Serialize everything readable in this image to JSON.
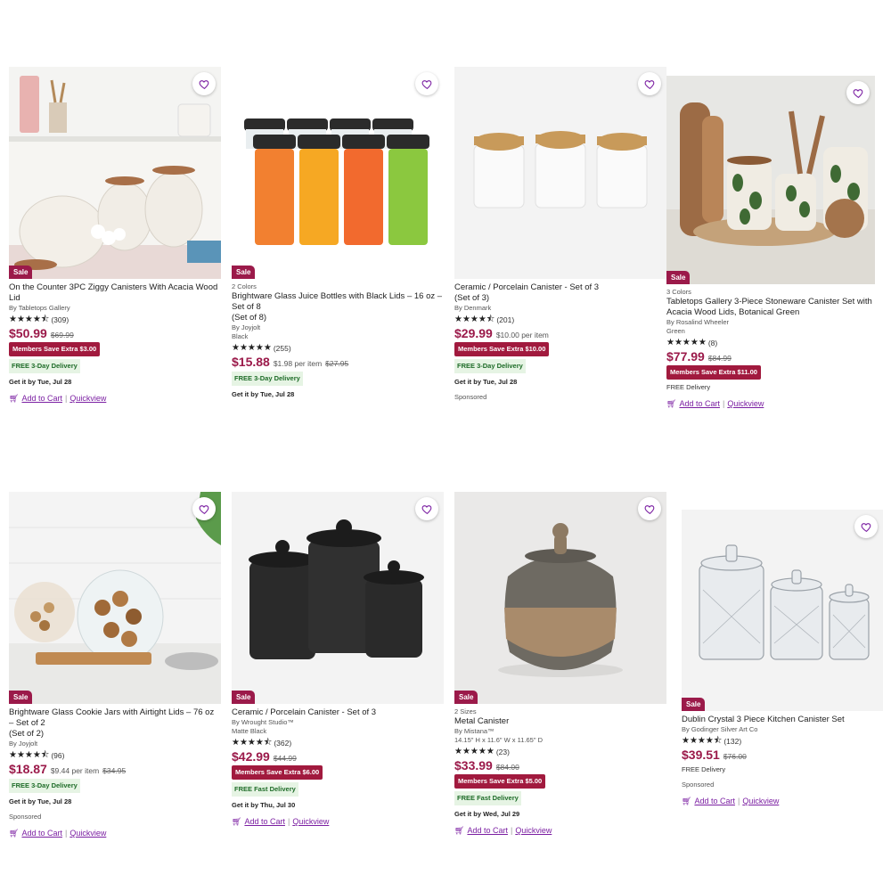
{
  "products": [
    {
      "id": "p1",
      "colors": "",
      "title": "On the Counter 3PC Ziggy Canisters With Acacia Wood Lid",
      "brand": "By Tabletops Gallery",
      "sub": "",
      "rating_count": "(309)",
      "stars": "★★★★⯪",
      "price": "$50.99",
      "per_item": "",
      "was": "$69.99",
      "members": "Members Save Extra $3.00",
      "shipping": "FREE 3-Day Delivery",
      "shipping_style": "green",
      "getit": "Get it by Tue, Jul 28",
      "sponsored": "",
      "sale": "Sale",
      "add_to_cart": "Add to Cart",
      "quickview": "Quickview"
    },
    {
      "id": "p2",
      "colors": "2 Colors",
      "title": "Brightware Glass Juice Bottles with Black Lids – 16 oz – Set of 8",
      "subtitle2": "(Set of 8)",
      "brand": "By Joyjolt",
      "sub": "Black",
      "rating_count": "(255)",
      "stars": "★★★★★",
      "price": "$15.88",
      "per_item": "$1.98 per item",
      "was": "$27.95",
      "members": "",
      "shipping": "FREE 3-Day Delivery",
      "shipping_style": "green",
      "getit": "Get it by Tue, Jul 28",
      "sponsored": "",
      "sale": "Sale",
      "add_to_cart": "",
      "quickview": ""
    },
    {
      "id": "p3",
      "colors": "",
      "title": "Ceramic / Porcelain Canister - Set of 3",
      "subtitle2": "(Set of 3)",
      "brand": "By Denmark",
      "sub": "",
      "rating_count": "(201)",
      "stars": "★★★★⯪",
      "price": "$29.99",
      "per_item": "$10.00 per item",
      "was": "",
      "members": "Members Save Extra $10.00",
      "shipping": "FREE 3-Day Delivery",
      "shipping_style": "green",
      "getit": "Get it by Tue, Jul 28",
      "sponsored": "Sponsored",
      "sale": "",
      "add_to_cart": "",
      "quickview": ""
    },
    {
      "id": "p4",
      "colors": "3 Colors",
      "title": "Tabletops Gallery 3-Piece Stoneware Canister Set with Acacia Wood Lids, Botanical Green",
      "brand": "By Rosalind Wheeler",
      "sub": "Green",
      "rating_count": "(8)",
      "stars": "★★★★★",
      "price": "$77.99",
      "per_item": "",
      "was": "$84.99",
      "members": "Members Save Extra $11.00",
      "shipping": "FREE Delivery",
      "shipping_style": "plain",
      "getit": "",
      "sponsored": "",
      "sale": "Sale",
      "add_to_cart": "Add to Cart",
      "quickview": "Quickview"
    },
    {
      "id": "p5",
      "colors": "",
      "title": "Brightware Glass Cookie Jars with Airtight Lids – 76 oz – Set of 2",
      "subtitle2": "(Set of 2)",
      "brand": "By Joyjolt",
      "sub": "",
      "rating_count": "(96)",
      "stars": "★★★★⯪",
      "price": "$18.87",
      "per_item": "$9.44 per item",
      "was": "$34.95",
      "members": "",
      "shipping": "FREE 3-Day Delivery",
      "shipping_style": "green",
      "getit": "Get it by Tue, Jul 28",
      "sponsored": "Sponsored",
      "sale": "Sale",
      "add_to_cart": "Add to Cart",
      "quickview": "Quickview"
    },
    {
      "id": "p6",
      "colors": "",
      "title": "Ceramic / Porcelain Canister - Set of 3",
      "brand": "By Wrought Studio™",
      "sub": "Matte Black",
      "rating_count": "(362)",
      "stars": "★★★★⯪",
      "price": "$42.99",
      "per_item": "",
      "was": "$44.99",
      "members": "Members Save Extra $6.00",
      "shipping": "FREE Fast Delivery",
      "shipping_style": "green",
      "getit": "Get it by Thu, Jul 30",
      "sponsored": "",
      "sale": "Sale",
      "add_to_cart": "Add to Cart",
      "quickview": "Quickview"
    },
    {
      "id": "p7",
      "colors": "2 Sizes",
      "title": "Metal Canister",
      "brand": "By Mistana™",
      "sub": "14.15\" H x 11.6\" W x 11.65\" D",
      "rating_count": "(23)",
      "stars": "★★★★★",
      "price": "$33.99",
      "per_item": "",
      "was": "$84.00",
      "members": "Members Save Extra $5.00",
      "shipping": "FREE Fast Delivery",
      "shipping_style": "green",
      "getit": "Get it by Wed, Jul 29",
      "sponsored": "",
      "sale": "Sale",
      "add_to_cart": "Add to Cart",
      "quickview": "Quickview"
    },
    {
      "id": "p8",
      "colors": "",
      "title": "Dublin Crystal 3 Piece Kitchen Canister Set",
      "brand": "By Godinger Silver Art Co",
      "sub": "",
      "rating_count": "(132)",
      "stars": "★★★★⯪",
      "price": "$39.51",
      "per_item": "",
      "was": "$76.00",
      "members": "",
      "shipping": "FREE Delivery",
      "shipping_style": "plain",
      "getit": "",
      "sponsored": "Sponsored",
      "sale": "Sale",
      "add_to_cart": "Add to Cart",
      "quickview": "Quickview"
    }
  ],
  "colors": {
    "sale": "#9b1a4a",
    "members": "#a11a3e",
    "link": "#7b1fa2",
    "ship_green": "#1d6b27"
  }
}
